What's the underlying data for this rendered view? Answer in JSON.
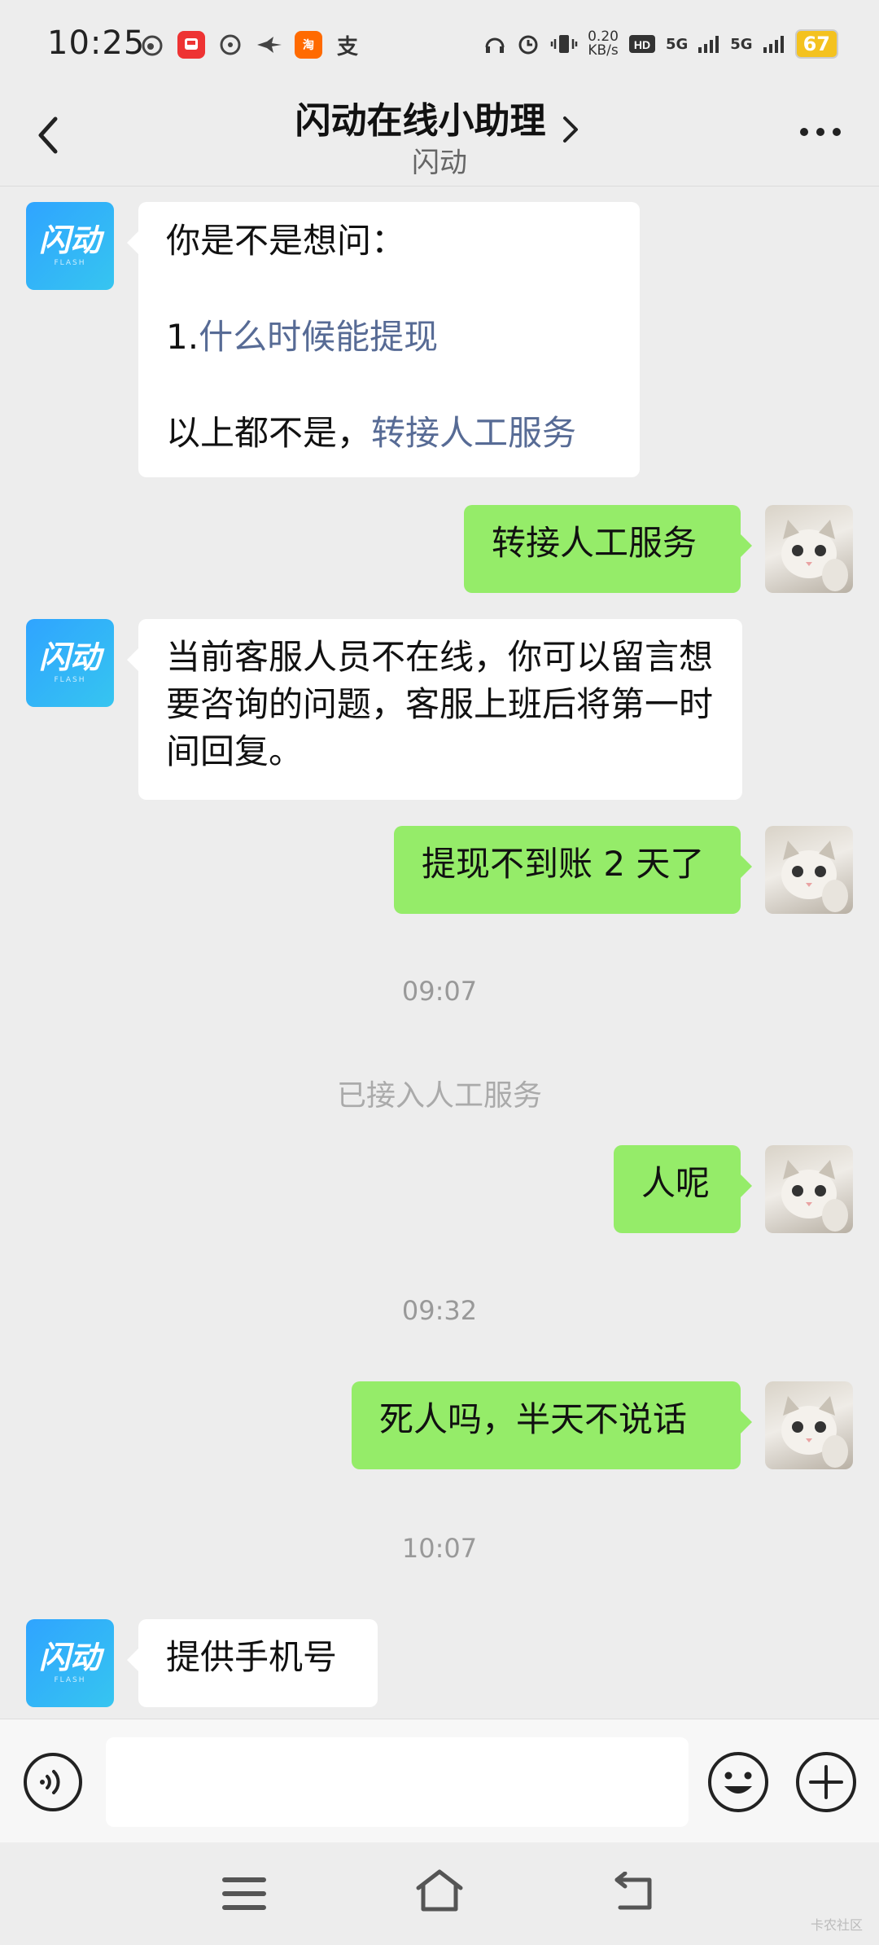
{
  "status_bar": {
    "time": "10:25",
    "app_icons": [
      "weibo-icon",
      "train-icon",
      "steering-icon",
      "bird-icon",
      "taobao-icon",
      "alipay-icon"
    ],
    "speed": "0.20\nKB/s",
    "network": "5G",
    "battery": "67"
  },
  "header": {
    "title": "闪动在线小助理",
    "subtitle": "闪动"
  },
  "bot": {
    "avatar_text": "闪动",
    "avatar_sub": "FLASH"
  },
  "messages": {
    "m1": {
      "line1": "你是不是想问：",
      "line2_prefix": "1.",
      "line2_link": "什么时候能提现",
      "line3_prefix": "以上都不是，",
      "line3_link": "转接人工服务"
    },
    "m2": "转接人工服务",
    "m3": "当前客服人员不在线，你可以留言想要咨询的问题，客服上班后将第一时间回复。",
    "m4": "提现不到账 2 天了",
    "t1": "09:07",
    "sys1": "已接入人工服务",
    "m5": "人呢",
    "t2": "09:32",
    "m6": "死人吗，半天不说话",
    "t3": "10:07",
    "m7": "提供手机号"
  },
  "input": {
    "placeholder": ""
  },
  "watermark": "卡农社区",
  "colors": {
    "user_bubble": "#95ec69",
    "link": "#576b95",
    "background": "#ededed"
  }
}
